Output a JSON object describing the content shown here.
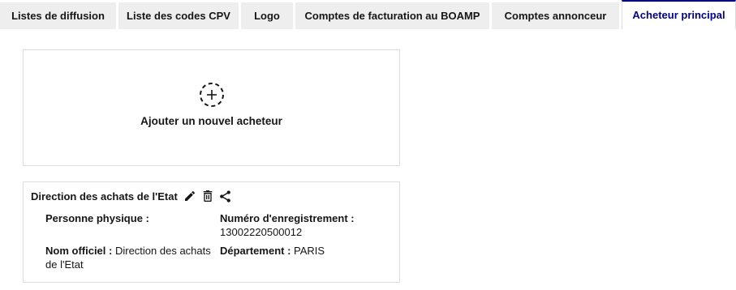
{
  "tabs": [
    {
      "label": "Listes de diffusion",
      "active": false
    },
    {
      "label": "Liste des codes CPV",
      "active": false
    },
    {
      "label": "Logo",
      "active": false
    },
    {
      "label": "Comptes de facturation au BOAMP",
      "active": false
    },
    {
      "label": "Comptes annonceur",
      "active": false
    },
    {
      "label": "Acheteur principal",
      "active": true
    }
  ],
  "add_card": {
    "icon": "plus-circle-dashed-icon",
    "label": "Ajouter un nouvel acheteur"
  },
  "buyer": {
    "name": "Direction des achats de l'Etat",
    "actions": [
      "edit-icon",
      "delete-icon",
      "share-icon"
    ],
    "fields": {
      "personne_physique_label": "Personne physique :",
      "personne_physique_value": "",
      "numero_label": "Numéro d'enregistrement :",
      "numero_value": "13002220500012",
      "nom_officiel_label": "Nom officiel :",
      "nom_officiel_value": "Direction des achats de l'Etat",
      "departement_label": "Département :",
      "departement_value": "PARIS"
    }
  },
  "colors": {
    "accent": "#000091",
    "tab_bg": "#eeeeee",
    "border": "#dddddd",
    "text": "#161616"
  }
}
